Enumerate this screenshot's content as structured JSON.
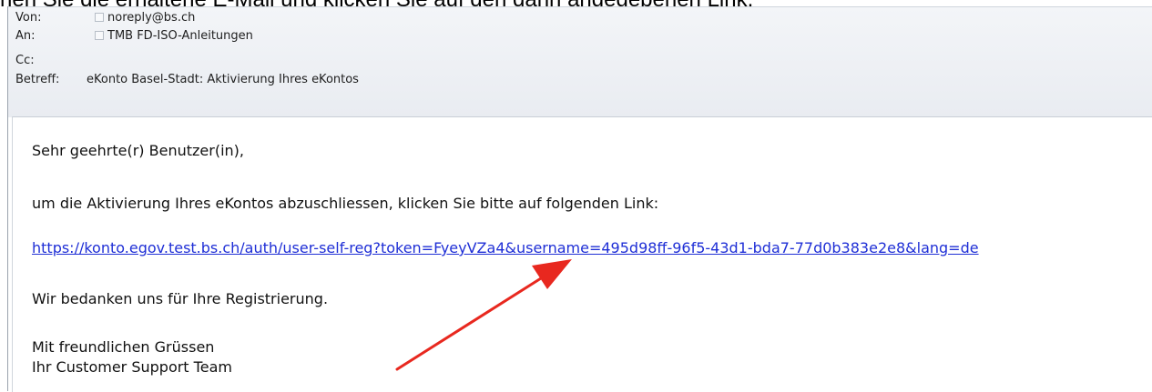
{
  "caption": {
    "text": "nen Sie die erhaltene E-Mail und klicken Sie auf den dann angegebenen Link."
  },
  "header": {
    "from_label": "Von:",
    "from_value": "noreply@bs.ch",
    "to_label": "An:",
    "to_value": "TMB FD-ISO-Anleitungen",
    "cc_label": "Cc:",
    "subject_label": "Betreff:",
    "subject_value": "eKonto Basel-Stadt: Aktivierung Ihres eKontos"
  },
  "body": {
    "greeting": "Sehr geehrte(r) Benutzer(in),",
    "instruction": "um die Aktivierung Ihres eKontos abzuschliessen, klicken Sie bitte auf folgenden Link:",
    "link": "https://konto.egov.test.bs.ch/auth/user-self-reg?token=FyeyVZa4&username=495d98ff-96f5-43d1-bda7-77d0b383e2e8&lang=de",
    "thanks": "Wir bedanken uns für Ihre Registrierung.",
    "closing": "Mit freundlichen Grüssen",
    "signature": "Ihr Customer Support Team"
  },
  "annotation": {
    "arrow_color": "#e8281f",
    "icon": "red-arrow-icon"
  },
  "colors": {
    "link": "#1f2fd6",
    "header_bg": "#eef1f5"
  }
}
